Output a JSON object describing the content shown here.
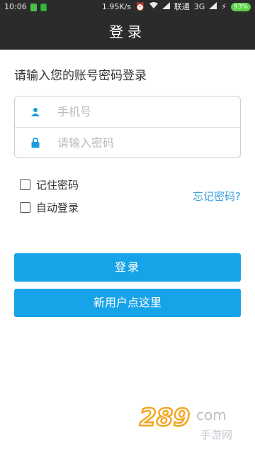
{
  "status": {
    "time": "10:06",
    "speed": "1.95K/s",
    "carrier": "联通",
    "network": "3G",
    "battery": "93%"
  },
  "header": {
    "title": "登录"
  },
  "prompt": "请输入您的账号密码登录",
  "form": {
    "phone_placeholder": "手机号",
    "password_placeholder": "请输入密码"
  },
  "options": {
    "remember_label": "记住密码",
    "autologin_label": "自动登录",
    "forgot_label": "忘记密码?"
  },
  "buttons": {
    "login_label": "登录",
    "register_label": "新用户点这里"
  },
  "watermark": {
    "brand": "289",
    "suffix": "com",
    "tagline": "手游网"
  },
  "colors": {
    "accent": "#17a3e8",
    "link": "#3aa0e0",
    "header_bg": "#2b2b2b"
  }
}
